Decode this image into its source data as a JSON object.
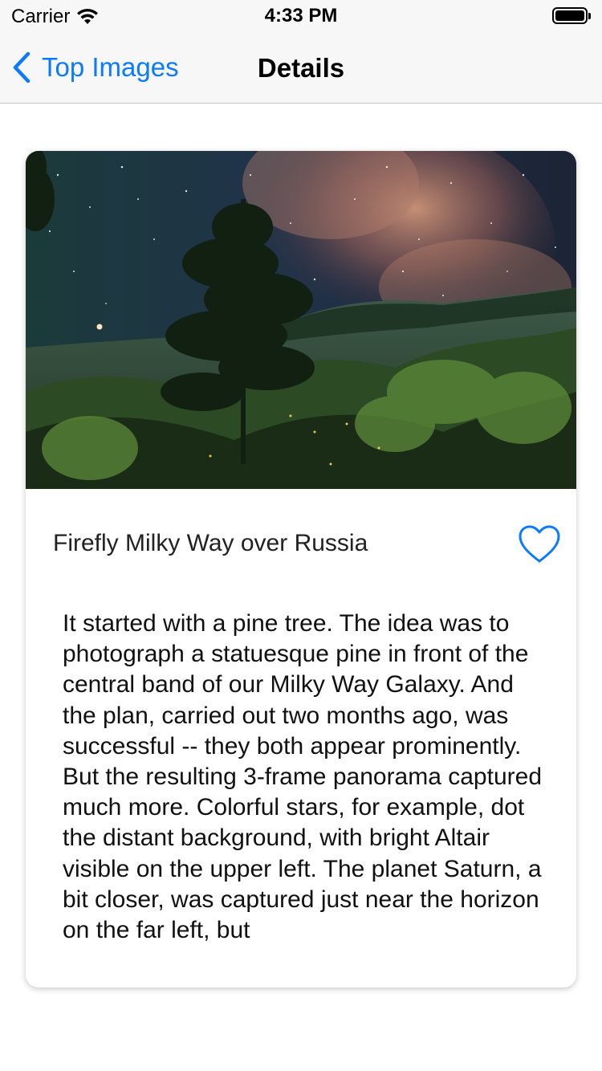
{
  "status_bar": {
    "carrier": "Carrier",
    "time": "4:33 PM",
    "wifi_icon": "wifi-icon",
    "battery_icon": "battery-icon"
  },
  "nav_bar": {
    "back_label": "Top Images",
    "back_icon": "chevron-left-icon",
    "title": "Details"
  },
  "card": {
    "image_alt": "Firefly Milky Way over Russia",
    "title": "Firefly Milky Way over Russia",
    "favorite_icon": "heart-outline-icon",
    "description": "It started with a pine tree. The idea was to photograph a statuesque pine in front of the central band of our Milky Way Galaxy. And the plan, carried out two months ago, was successful -- they both appear prominently. But the resulting 3-frame panorama captured much more. Colorful stars, for example, dot the distant background, with bright Altair visible on the upper left. The planet Saturn, a bit closer, was captured just near the horizon on the far left, but"
  },
  "colors": {
    "accent": "#0a7aff",
    "nav_background": "#f7f7f7",
    "card_background": "#ffffff"
  }
}
